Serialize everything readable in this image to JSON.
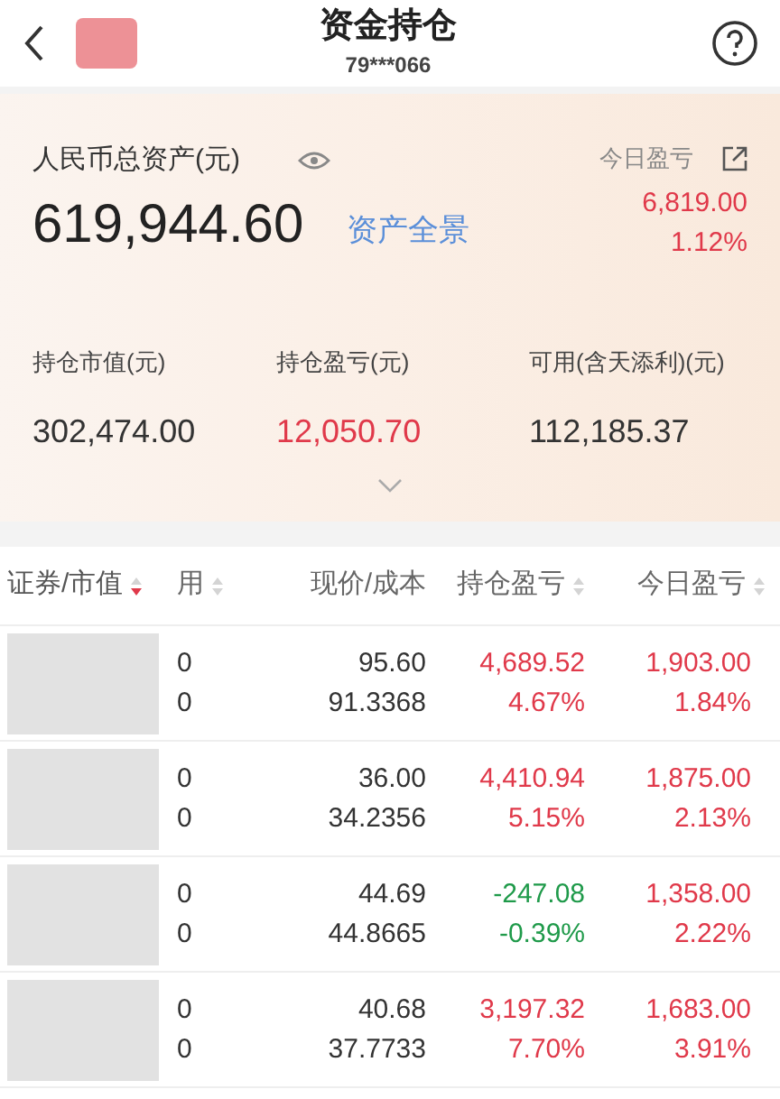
{
  "header": {
    "title": "资金持仓",
    "account": "79***066"
  },
  "summary": {
    "total_label": "人民币总资产(元)",
    "total_value": "619,944.60",
    "overview_link": "资产全景",
    "today_label": "今日盈亏",
    "today_value": "6,819.00",
    "today_percent": "1.12%",
    "today_gain": true,
    "stats": [
      {
        "label": "持仓市值(元)",
        "value": "302,474.00",
        "gain": false
      },
      {
        "label": "持仓盈亏(元)",
        "value": "12,050.70",
        "gain": true
      },
      {
        "label": "可用(含天添利)(元)",
        "value": "112,185.37",
        "gain": false
      }
    ]
  },
  "table": {
    "columns": [
      {
        "label": "证券/市值",
        "sortable": true,
        "selected": true
      },
      {
        "label": "用",
        "sortable": true,
        "selected": false
      },
      {
        "label": "现价/成本",
        "sortable": false,
        "selected": false
      },
      {
        "label": "持仓盈亏",
        "sortable": true,
        "selected": false
      },
      {
        "label": "今日盈亏",
        "sortable": true,
        "selected": false
      }
    ],
    "rows": [
      {
        "column_2": [
          "0",
          "0"
        ],
        "price": "95.60",
        "cost": "91.3368",
        "pnl": "4,689.52",
        "pnl_percent": "4.67%",
        "pnl_loss": false,
        "today": "1,903.00",
        "today_percent": "1.84%",
        "today_loss": false
      },
      {
        "column_2": [
          "0",
          "0"
        ],
        "price": "36.00",
        "cost": "34.2356",
        "pnl": "4,410.94",
        "pnl_percent": "5.15%",
        "pnl_loss": false,
        "today": "1,875.00",
        "today_percent": "2.13%",
        "today_loss": false
      },
      {
        "column_2": [
          "0",
          "0"
        ],
        "price": "44.69",
        "cost": "44.8665",
        "pnl": "-247.08",
        "pnl_percent": "-0.39%",
        "pnl_loss": true,
        "today": "1,358.00",
        "today_percent": "2.22%",
        "today_loss": false
      },
      {
        "column_2": [
          "0",
          "0"
        ],
        "price": "40.68",
        "cost": "37.7733",
        "pnl": "3,197.32",
        "pnl_percent": "7.70%",
        "pnl_loss": false,
        "today": "1,683.00",
        "today_percent": "3.91%",
        "today_loss": false
      }
    ]
  }
}
